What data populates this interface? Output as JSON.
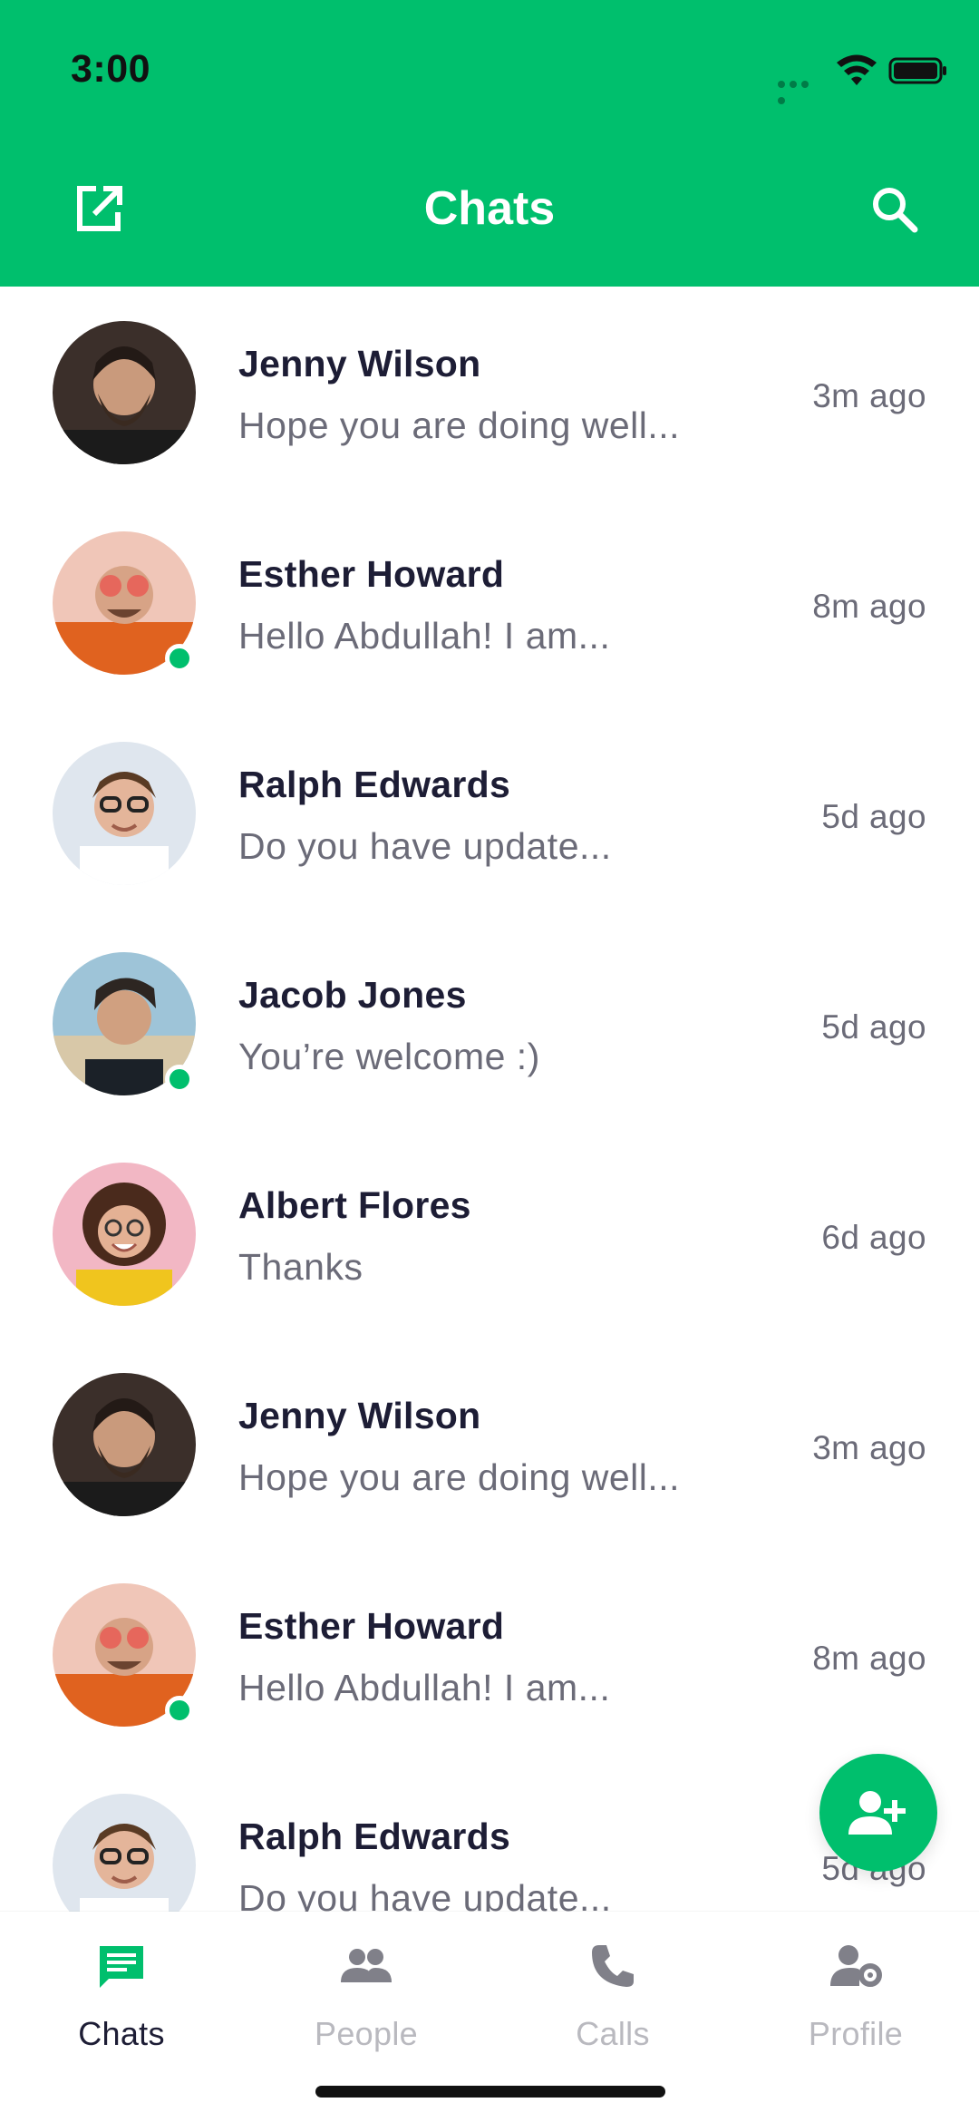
{
  "status_bar": {
    "time": "3:00",
    "icons": [
      "signal-dots-icon",
      "wifi-icon",
      "battery-icon"
    ]
  },
  "header": {
    "title": "Chats",
    "left_icon": "external-link-icon",
    "right_icon": "search-icon",
    "color": "#00BF6D"
  },
  "chats": [
    {
      "name": "Jenny Wilson",
      "message": "Hope you are doing well...",
      "time": "3m ago",
      "online": false
    },
    {
      "name": "Esther Howard",
      "message": "Hello Abdullah! I am...",
      "time": "8m ago",
      "online": true
    },
    {
      "name": "Ralph Edwards",
      "message": "Do you have update...",
      "time": "5d ago",
      "online": false
    },
    {
      "name": "Jacob Jones",
      "message": "You’re welcome :)",
      "time": "5d ago",
      "online": true
    },
    {
      "name": "Albert Flores",
      "message": "Thanks",
      "time": "6d ago",
      "online": false
    },
    {
      "name": "Jenny Wilson",
      "message": "Hope you are doing well...",
      "time": "3m ago",
      "online": false
    },
    {
      "name": "Esther Howard",
      "message": "Hello Abdullah! I am...",
      "time": "8m ago",
      "online": true
    },
    {
      "name": "Ralph Edwards",
      "message": "Do you have update...",
      "time": "5d ago",
      "online": false
    }
  ],
  "fab": {
    "icon": "add-person-icon"
  },
  "bottom_nav": [
    {
      "label": "Chats",
      "icon": "chat-icon",
      "active": true
    },
    {
      "label": "People",
      "icon": "people-icon",
      "active": false
    },
    {
      "label": "Calls",
      "icon": "phone-icon",
      "active": false
    },
    {
      "label": "Profile",
      "icon": "profile-settings-icon",
      "active": false
    }
  ]
}
